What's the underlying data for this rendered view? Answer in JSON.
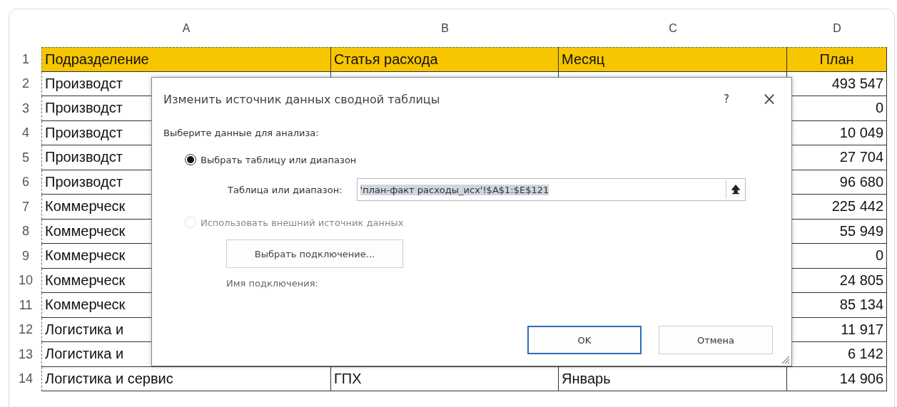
{
  "sheet": {
    "columns": [
      "A",
      "B",
      "C",
      "D"
    ],
    "rows": [
      {
        "number": "1",
        "kind": "header",
        "a": "Подразделение",
        "b": "Статья расхода",
        "c": "Месяц",
        "d": "План"
      },
      {
        "number": "2",
        "kind": "data",
        "a": "Производст",
        "d": "493 547"
      },
      {
        "number": "3",
        "kind": "data",
        "a": "Производст",
        "d": "0"
      },
      {
        "number": "4",
        "kind": "data",
        "a": "Производст",
        "d": "10 049"
      },
      {
        "number": "5",
        "kind": "data",
        "a": "Производст",
        "d": "27 704"
      },
      {
        "number": "6",
        "kind": "data",
        "a": "Производст",
        "d": "96 680"
      },
      {
        "number": "7",
        "kind": "data",
        "a": "Коммерческ",
        "d": "225 442"
      },
      {
        "number": "8",
        "kind": "data",
        "a": "Коммерческ",
        "d": "55 949"
      },
      {
        "number": "9",
        "kind": "data",
        "a": "Коммерческ",
        "d": "0"
      },
      {
        "number": "10",
        "kind": "data",
        "a": "Коммерческ",
        "d": "24 805"
      },
      {
        "number": "11",
        "kind": "data",
        "a": "Коммерческ",
        "d": "85 134"
      },
      {
        "number": "12",
        "kind": "data",
        "a": "Логистика и",
        "d": "11 917"
      },
      {
        "number": "13",
        "kind": "data",
        "a": "Логистика и",
        "d": "6 142"
      },
      {
        "number": "14",
        "kind": "data",
        "a": "Логистика и сервис",
        "b": "ГПХ",
        "c": "Январь",
        "d": "14 906"
      }
    ]
  },
  "dialog": {
    "title": "Изменить источник данных сводной таблицы",
    "help": "?",
    "close": "×",
    "prompt": "Выберите данные для анализа:",
    "options": [
      {
        "label": "Выбрать таблицу или диапазон",
        "selected": true,
        "disabled": false
      },
      {
        "label": "Использовать внешний источник данных",
        "selected": false,
        "disabled": true
      }
    ],
    "range_label": "Таблица или диапазон:",
    "range_value": "'план-факт расходы_исх'!$A$1:$E$121",
    "connection_button": "Выбрать подключение...",
    "connection_name_label": "Имя подключения:",
    "buttons": [
      {
        "label": "OK",
        "default": true
      },
      {
        "label": "Отмена",
        "default": false
      }
    ]
  }
}
